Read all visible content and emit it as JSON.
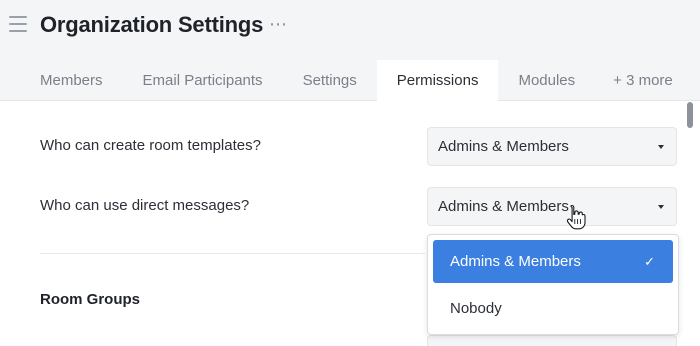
{
  "header": {
    "menu_icon": "hamburger-menu-icon",
    "title": "Organization Settings",
    "more_icon": "more-options-icon",
    "more_glyph": "⋯"
  },
  "tabs": [
    {
      "label": "Members",
      "active": false
    },
    {
      "label": "Email Participants",
      "active": false
    },
    {
      "label": "Settings",
      "active": false
    },
    {
      "label": "Permissions",
      "active": true
    },
    {
      "label": "Modules",
      "active": false
    },
    {
      "label": "+ 3 more",
      "active": false
    }
  ],
  "permissions": {
    "room_templates": {
      "label": "Who can create room templates?",
      "value": "Admins & Members"
    },
    "direct_messages": {
      "label": "Who can use direct messages?",
      "value": "Admins & Members"
    }
  },
  "section": {
    "title": "Room Groups"
  },
  "dropdown": {
    "options": [
      {
        "label": "Admins & Members",
        "selected": true
      },
      {
        "label": "Nobody",
        "selected": false
      }
    ],
    "check_glyph": "✓"
  },
  "colors": {
    "accent": "#3b7fe0",
    "header_bg": "#f4f5f7",
    "text": "#2b2f36",
    "muted": "#7a8089"
  },
  "icons": {
    "caret": "caret-down-icon",
    "check": "check-icon",
    "cursor": "hand-pointer-icon"
  }
}
